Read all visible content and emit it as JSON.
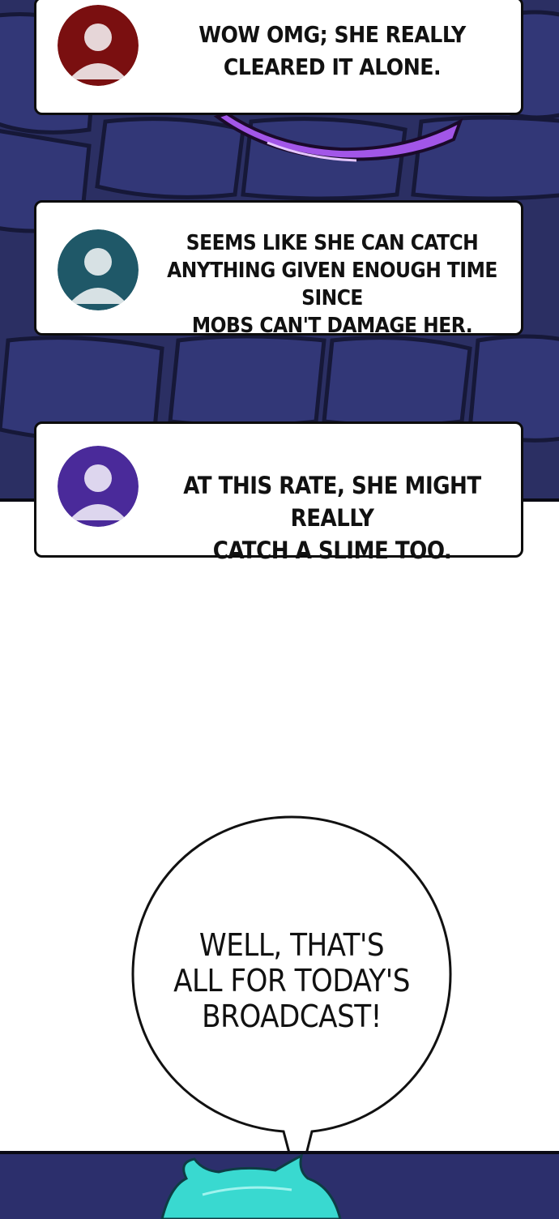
{
  "comments": [
    {
      "text": "WOW OMG; SHE REALLY\nCLEARED IT ALONE.",
      "avatar_color": "#7a0f10",
      "avatar_fg": "#e6d6d8"
    },
    {
      "text": "SEEMS LIKE SHE CAN CATCH\nANYTHING GIVEN ENOUGH TIME SINCE\nMOBS CAN'T DAMAGE HER.",
      "avatar_color": "#1f5868",
      "avatar_fg": "#d7e1e4"
    },
    {
      "text": "AT THIS RATE, SHE MIGHT REALLY\nCATCH A SLIME TOO.",
      "avatar_color": "#4a2a9a",
      "avatar_fg": "#ddd6ee"
    }
  ],
  "speech_bubble": {
    "text": "WELL, THAT'S\nALL FOR TODAY'S\nBROADCAST!"
  },
  "colors": {
    "dungeon": "#2b2f63",
    "slime": "#a256e8",
    "hair": "#39d9d0"
  }
}
